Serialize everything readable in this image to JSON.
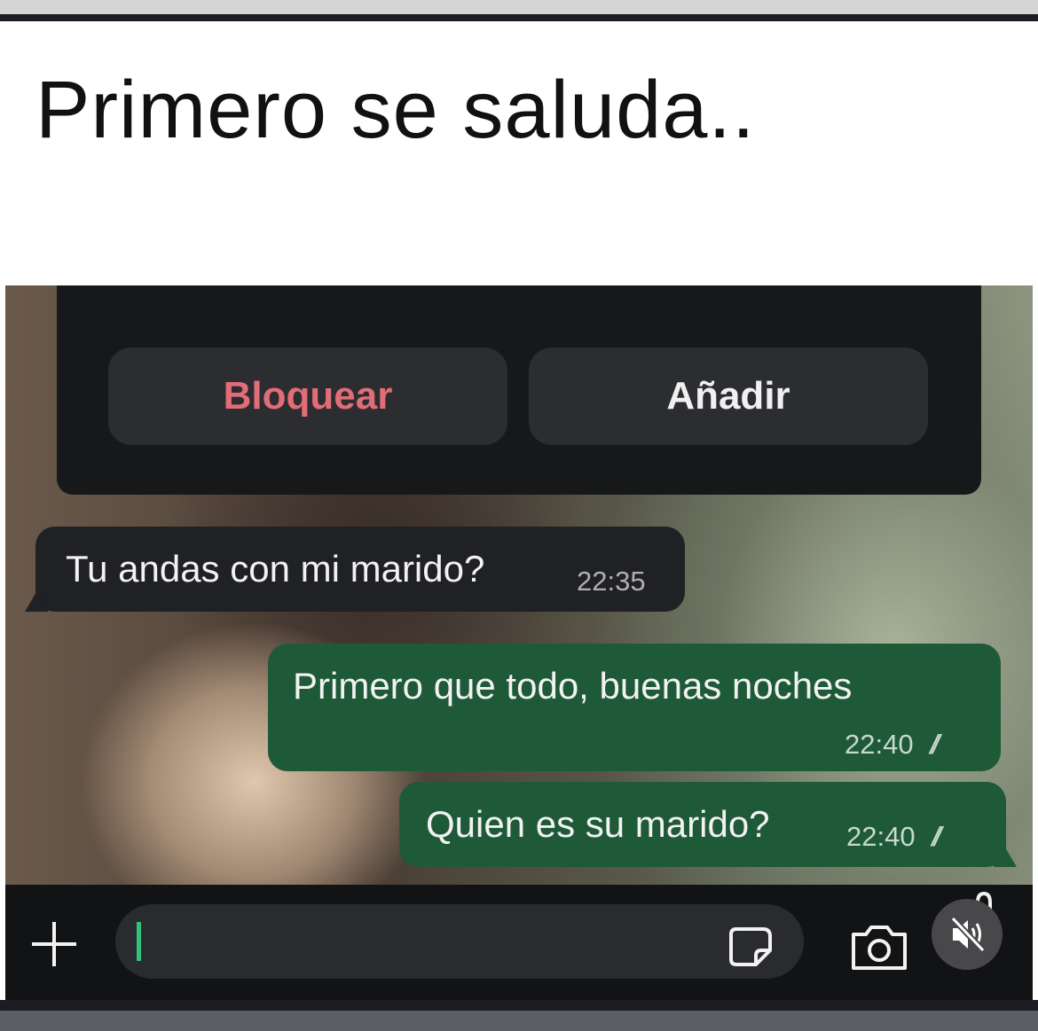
{
  "caption": "Primero se saluda..",
  "actions": {
    "block_label": "Bloquear",
    "add_label": "Añadir"
  },
  "messages": [
    {
      "direction": "incoming",
      "text": "Tu andas con mi marido?",
      "time": "22:35"
    },
    {
      "direction": "outgoing",
      "text": "Primero que todo, buenas noches",
      "time": "22:40",
      "status": "read"
    },
    {
      "direction": "outgoing",
      "text": "Quien es su marido?",
      "time": "22:40",
      "status": "read"
    }
  ],
  "composer": {
    "value": "",
    "icons": [
      "plus-icon",
      "sticker-icon",
      "camera-icon",
      "microphone-icon"
    ]
  },
  "overlay": {
    "mute_icon": "speaker-muted-icon"
  },
  "colors": {
    "block_text": "#e26d78",
    "incoming_bubble": "#202124",
    "outgoing_bubble": "#1f5a38",
    "cursor": "#2ec27e"
  }
}
